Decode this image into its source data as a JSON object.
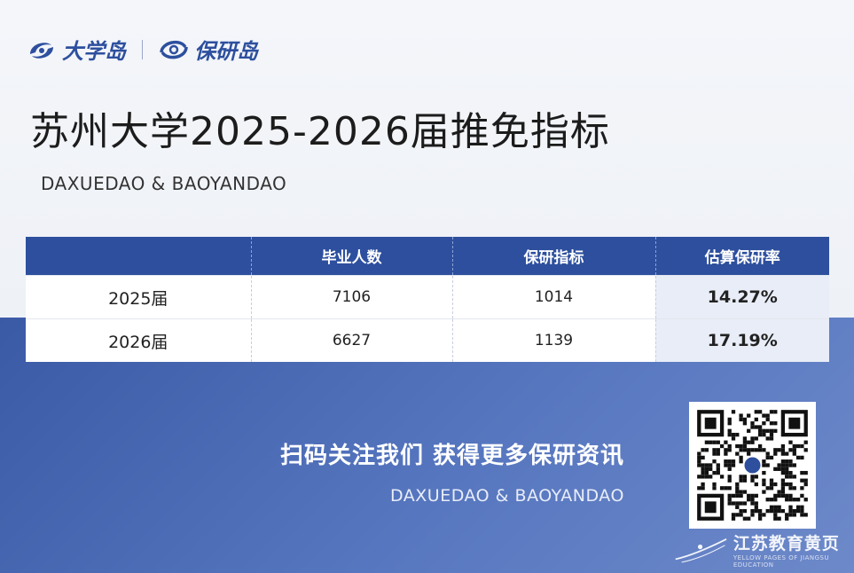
{
  "brand": {
    "logo1_text": "大学岛",
    "logo2_text": "保研岛"
  },
  "page": {
    "title": "苏州大学2025-2026届推免指标",
    "subtitle": "DAXUEDAO & BAOYANDAO"
  },
  "table": {
    "headers": [
      "",
      "毕业人数",
      "保研指标",
      "估算保研率"
    ],
    "rows": [
      {
        "year": "2025届",
        "graduates": "7106",
        "quota": "1014",
        "rate": "14.27%"
      },
      {
        "year": "2026届",
        "graduates": "6627",
        "quota": "1139",
        "rate": "17.19%"
      }
    ]
  },
  "cta": {
    "title": "扫码关注我们 获得更多保研资讯",
    "subtitle": "DAXUEDAO & BAOYANDAO"
  },
  "watermark": {
    "cn": "江苏教育黄页",
    "en": "YELLOW PAGES OF JIANGSU EDUCATION"
  },
  "colors": {
    "brand_blue": "#2d4f9e",
    "table_header": "#2d4f9e",
    "rate_cell": "#e8edf7"
  },
  "icons": [
    "daxuedao-logo-icon",
    "baoyandao-logo-icon",
    "qr-code",
    "watermark-logo-icon"
  ]
}
